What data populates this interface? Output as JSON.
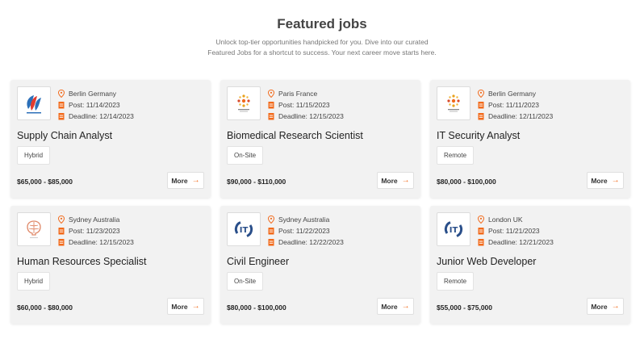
{
  "header": {
    "title": "Featured jobs",
    "subtitle_line1": "Unlock top-tier opportunities handpicked for you. Dive into our curated",
    "subtitle_line2": "Featured Jobs for a shortcut to success. Your next career move starts here."
  },
  "colors": {
    "accent": "#f26a1b",
    "card_bg": "#f2f2f2"
  },
  "jobs": [
    {
      "logo": "blue-red-leaf-logo",
      "location": "Berlin Germany",
      "post": "Post: 11/14/2023",
      "deadline": "Deadline: 12/14/2023",
      "title": "Supply Chain Analyst",
      "type": "Hybrid",
      "salary": "$65,000 - $85,000",
      "more": "More"
    },
    {
      "logo": "connect-dots-logo",
      "location": "Paris France",
      "post": "Post: 11/15/2023",
      "deadline": "Deadline: 12/15/2023",
      "title": "Biomedical Research Scientist",
      "type": "On-Site",
      "salary": "$90,000 - $110,000",
      "more": "More"
    },
    {
      "logo": "connect-dots-logo",
      "location": "Berlin Germany",
      "post": "Post: 11/11/2023",
      "deadline": "Deadline: 12/11/2023",
      "title": "IT Security Analyst",
      "type": "Remote",
      "salary": "$80,000 - $100,000",
      "more": "More"
    },
    {
      "logo": "brain-logo",
      "location": "Sydney Australia",
      "post": "Post: 11/23/2023",
      "deadline": "Deadline: 12/15/2023",
      "title": "Human Resources Specialist",
      "type": "Hybrid",
      "salary": "$60,000 - $80,000",
      "more": "More"
    },
    {
      "logo": "it-logo",
      "location": "Sydney Australia",
      "post": "Post: 11/22/2023",
      "deadline": "Deadline: 12/22/2023",
      "title": "Civil Engineer",
      "type": "On-Site",
      "salary": "$80,000 - $100,000",
      "more": "More"
    },
    {
      "logo": "it-logo",
      "location": "London UK",
      "post": "Post: 11/21/2023",
      "deadline": "Deadline: 12/21/2023",
      "title": "Junior Web Developer",
      "type": "Remote",
      "salary": "$55,000 - $75,000",
      "more": "More"
    }
  ]
}
